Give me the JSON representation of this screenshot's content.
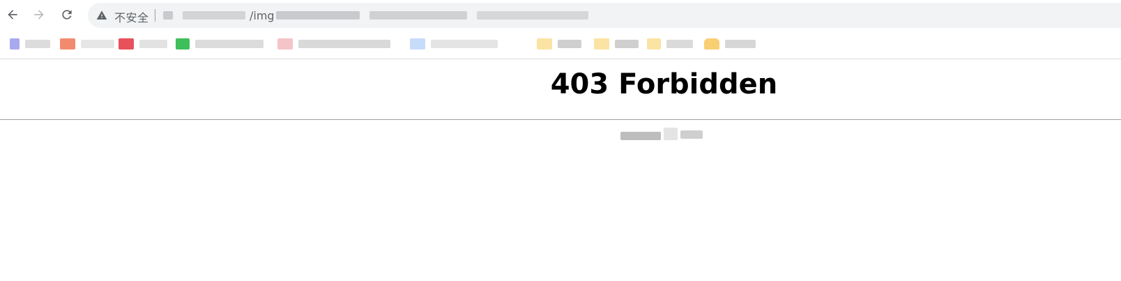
{
  "browser": {
    "nav": {
      "back_icon": "arrow-left-icon",
      "forward_icon": "arrow-right-icon",
      "reload_icon": "reload-icon"
    },
    "omnibox": {
      "warning_icon": "warning-triangle-icon",
      "security_label": "不安全",
      "url_visible_fragment": "/img"
    },
    "bookmarks": [
      {
        "favicon_color": "#a9a9f0"
      },
      {
        "favicon_color": "#f28b6e"
      },
      {
        "favicon_color": "#e8505b"
      },
      {
        "favicon_color": "#3fbf5a"
      },
      {
        "favicon_color": "#f5c4c8"
      },
      {
        "favicon_color": "#c7dbfb"
      },
      {
        "favicon_color": "#fbe3a3"
      },
      {
        "favicon_color": "#fbe3a3"
      },
      {
        "favicon_color": "#fbe3a3"
      },
      {
        "favicon_color": "#f8cf72"
      }
    ]
  },
  "page": {
    "heading": "403 Forbidden"
  },
  "colors": {
    "omnibox_bg": "#f1f3f4",
    "icon_gray": "#5f6368",
    "rule": "#a0a0a0"
  }
}
